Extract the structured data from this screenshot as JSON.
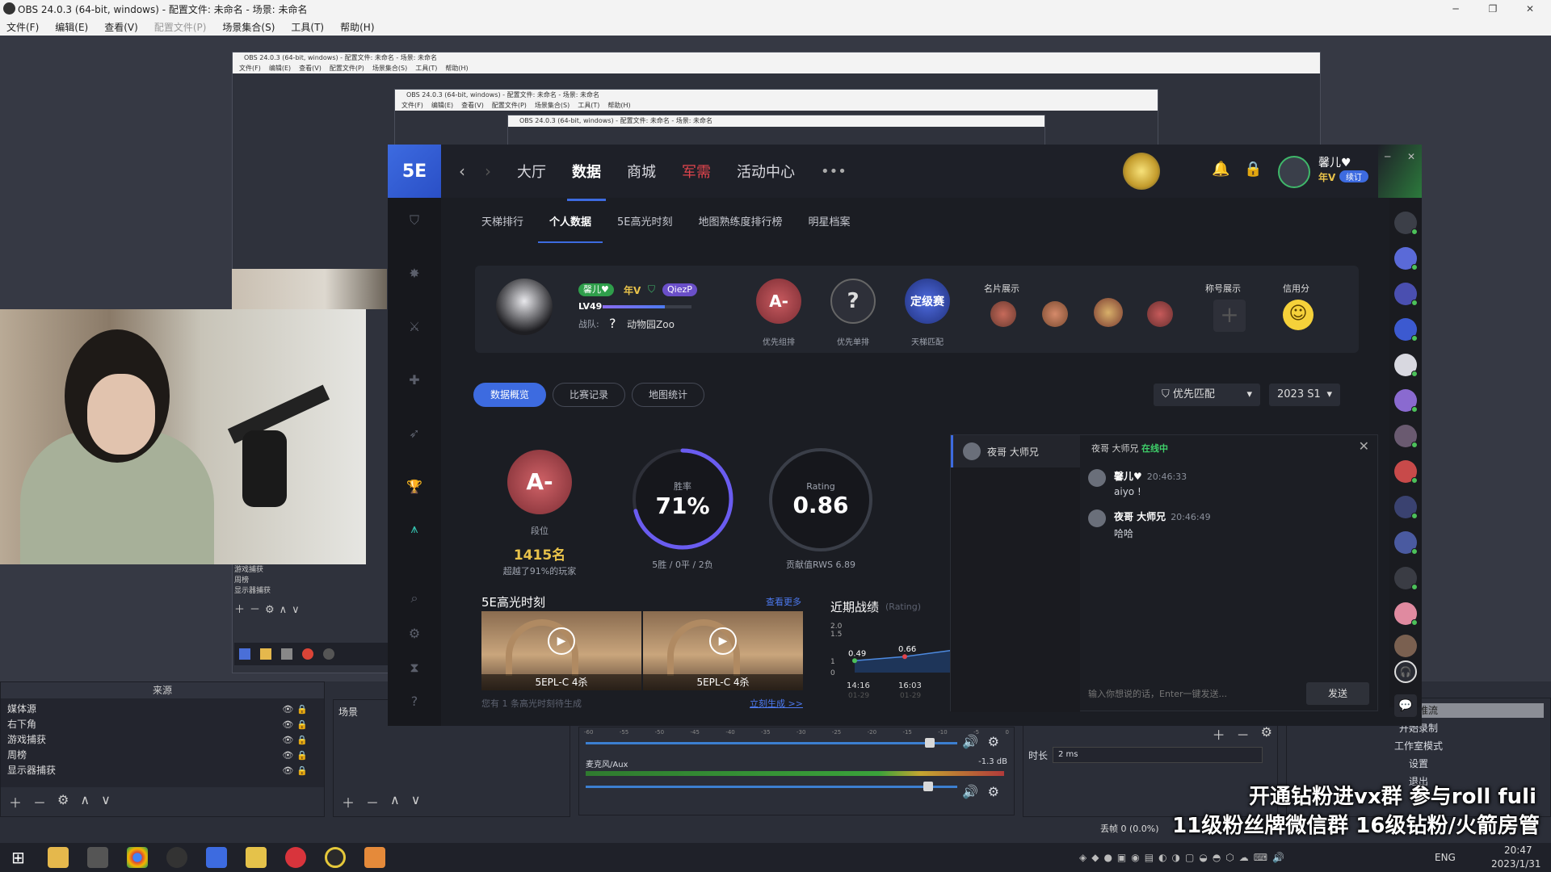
{
  "obs": {
    "title": "OBS 24.0.3 (64-bit, windows) - 配置文件: 未命名 - 场景: 未命名",
    "menu": [
      "文件(F)",
      "编辑(E)",
      "查看(V)",
      "配置文件(P)",
      "场景集合(S)",
      "工具(T)",
      "帮助(H)"
    ],
    "sources_header": "来源",
    "sources": [
      "媒体源",
      "右下角",
      "游戏捕获",
      "周榜",
      "显示器捕获"
    ],
    "scenes_header": "场景",
    "nested_sources": [
      "游戏捕获",
      "周榜",
      "显示器捕获"
    ],
    "mixer_track": "麦克风/Aux",
    "mixer_db": "-1.3 dB",
    "mixer_scale": [
      "-60",
      "-55",
      "-50",
      "-45",
      "-40",
      "-35",
      "-30",
      "-25",
      "-20",
      "-15",
      "-10",
      "-5",
      "0"
    ],
    "duration_label": "时长",
    "duration_value": "2 ms",
    "controls": [
      "开始录制",
      "工作室模式",
      "设置",
      "退出"
    ],
    "controls_partial": "开始推流",
    "dropped_frames": "丢帧 0 (0.0%)"
  },
  "overlay": {
    "line1": "开通钻粉进vx群 参与roll fuli",
    "line2": "11级粉丝牌微信群 16级钻粉/火箭房管"
  },
  "app": {
    "logo": "5E",
    "nav": [
      "大厅",
      "数据",
      "商城",
      "军需",
      "活动中心"
    ],
    "nav_more": "•••",
    "user_name": "馨儿♥",
    "user_vip": "年V",
    "user_sub": "续订",
    "subnav": [
      "天梯排行",
      "个人数据",
      "5E高光时刻",
      "地图熟练度排行榜",
      "明星档案"
    ],
    "profile": {
      "name": "馨儿♥",
      "vip": "年V",
      "tag": "QiezP",
      "level": "LV49",
      "team_label": "战队:",
      "team_icon": "?",
      "team_name": "动物园Zoo",
      "rank1_grade": "A-",
      "rank1_label": "优先组排",
      "rank2_grade": "?",
      "rank2_label": "优先单排",
      "rank3_grade": "定级赛",
      "rank3_label": "天梯匹配",
      "cards_title": "名片展示",
      "title_title": "称号展示",
      "credit_title": "信用分"
    },
    "tabs": [
      "数据概览",
      "比赛记录",
      "地图统计"
    ],
    "filter": "优先匹配",
    "season": "2023 S1",
    "stats": {
      "rank_grade": "A-",
      "rank_label": "段位",
      "rank_position": "1415名",
      "rank_desc": "超越了91%的玩家",
      "win_label": "胜率",
      "win_value": "71%",
      "win_detail": "5胜 / 0平 / 2负",
      "win_fraction": 0.71,
      "rating_label": "Rating",
      "rating_value": "0.86",
      "rating_detail": "贡献值RWS 6.89"
    },
    "highlights": {
      "title": "5E高光时刻",
      "more": "查看更多",
      "clips": [
        "5EPL-C 4杀",
        "5EPL-C 4杀"
      ],
      "note": "您有 1 条高光时刻待生成",
      "generate": "立刻生成 >>"
    },
    "recent": {
      "title": "近期战绩",
      "subtitle": "(Rating)",
      "y_ticks": [
        "2.0",
        "1.5",
        "1",
        "0"
      ],
      "points": [
        {
          "label": "0.49",
          "value": 0.49,
          "time": "14:16",
          "date": "01-29"
        },
        {
          "label": "0.66",
          "value": 0.66,
          "time": "16:03",
          "date": "01-29"
        }
      ]
    },
    "chat": {
      "contact": "夜哥 大师兄",
      "header_name": "夜哥 大师兄",
      "status": "在线中",
      "messages": [
        {
          "name": "馨儿♥",
          "time": "20:46:33",
          "text": "aiyo !"
        },
        {
          "name": "夜哥 大师兄",
          "time": "20:46:49",
          "text": "哈哈"
        }
      ],
      "placeholder": "输入你想说的话，Enter一键发送...",
      "send": "发送"
    }
  },
  "taskbar": {
    "lang": "ENG",
    "time": "20:47",
    "date": "2023/1/31"
  }
}
